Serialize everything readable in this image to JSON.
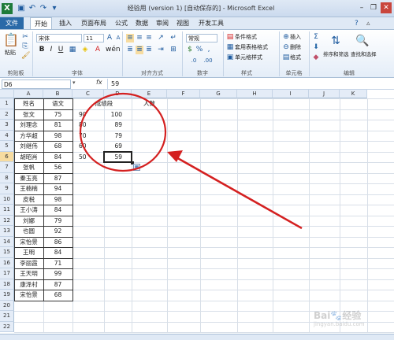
{
  "window": {
    "title": "经验用 (version 1) [自动保存的] - Microsoft Excel"
  },
  "tabs": [
    "文件",
    "开始",
    "插入",
    "页面布局",
    "公式",
    "数据",
    "审阅",
    "视图",
    "开发工具"
  ],
  "ribbon": {
    "clipboard": {
      "paste": "粘贴",
      "label": "剪贴板"
    },
    "font": {
      "name": "宋体",
      "size": "11",
      "label": "字体"
    },
    "alignment": {
      "label": "对齐方式"
    },
    "number": {
      "format": "常规",
      "label": "数字"
    },
    "styles": {
      "cond": "条件格式",
      "table": "套用表格格式",
      "cell": "单元格样式",
      "label": "样式"
    },
    "cells": {
      "insert": "插入",
      "delete": "删除",
      "format": "格式",
      "label": "单元格"
    },
    "editing": {
      "sort": "排序和筛选",
      "find": "查找和选择",
      "label": "编辑"
    }
  },
  "formula_bar": {
    "name_box": "D6",
    "fx": "fx",
    "value": "59"
  },
  "columns": [
    "A",
    "B",
    "C",
    "D",
    "E",
    "F",
    "G",
    "H",
    "I",
    "J",
    "K"
  ],
  "rows": [
    "1",
    "2",
    "3",
    "4",
    "5",
    "6",
    "7",
    "8",
    "9",
    "10",
    "11",
    "12",
    "13",
    "14",
    "15",
    "16",
    "17",
    "18",
    "19",
    "20",
    "21",
    "22"
  ],
  "headers": {
    "a1": "姓名",
    "b1": "语文",
    "c1": "成绩段",
    "e1": "人数"
  },
  "names": [
    "张文",
    "刘理念",
    "方华超",
    "刘继伟",
    "胡昭肖",
    "张帆",
    "秦玉亮",
    "王楠楠",
    "皮税",
    "王小涛",
    "刘娜",
    "也圆",
    "宋怡景",
    "王明",
    "李丽霞",
    "王天明",
    "康泽村",
    "宋怡景"
  ],
  "scores": [
    "75",
    "81",
    "98",
    "68",
    "84",
    "56",
    "87",
    "94",
    "98",
    "84",
    "79",
    "92",
    "86",
    "84",
    "71",
    "99",
    "87",
    "68"
  ],
  "c_values": [
    "90",
    "80",
    "70",
    "60",
    "50"
  ],
  "d_values": [
    "100",
    "89",
    "79",
    "69",
    "59"
  ],
  "watermark": "Bai 经验 jingyan.baidu.com",
  "colors": {
    "annotation": "#d42020",
    "accent": "#2a6aa8"
  }
}
